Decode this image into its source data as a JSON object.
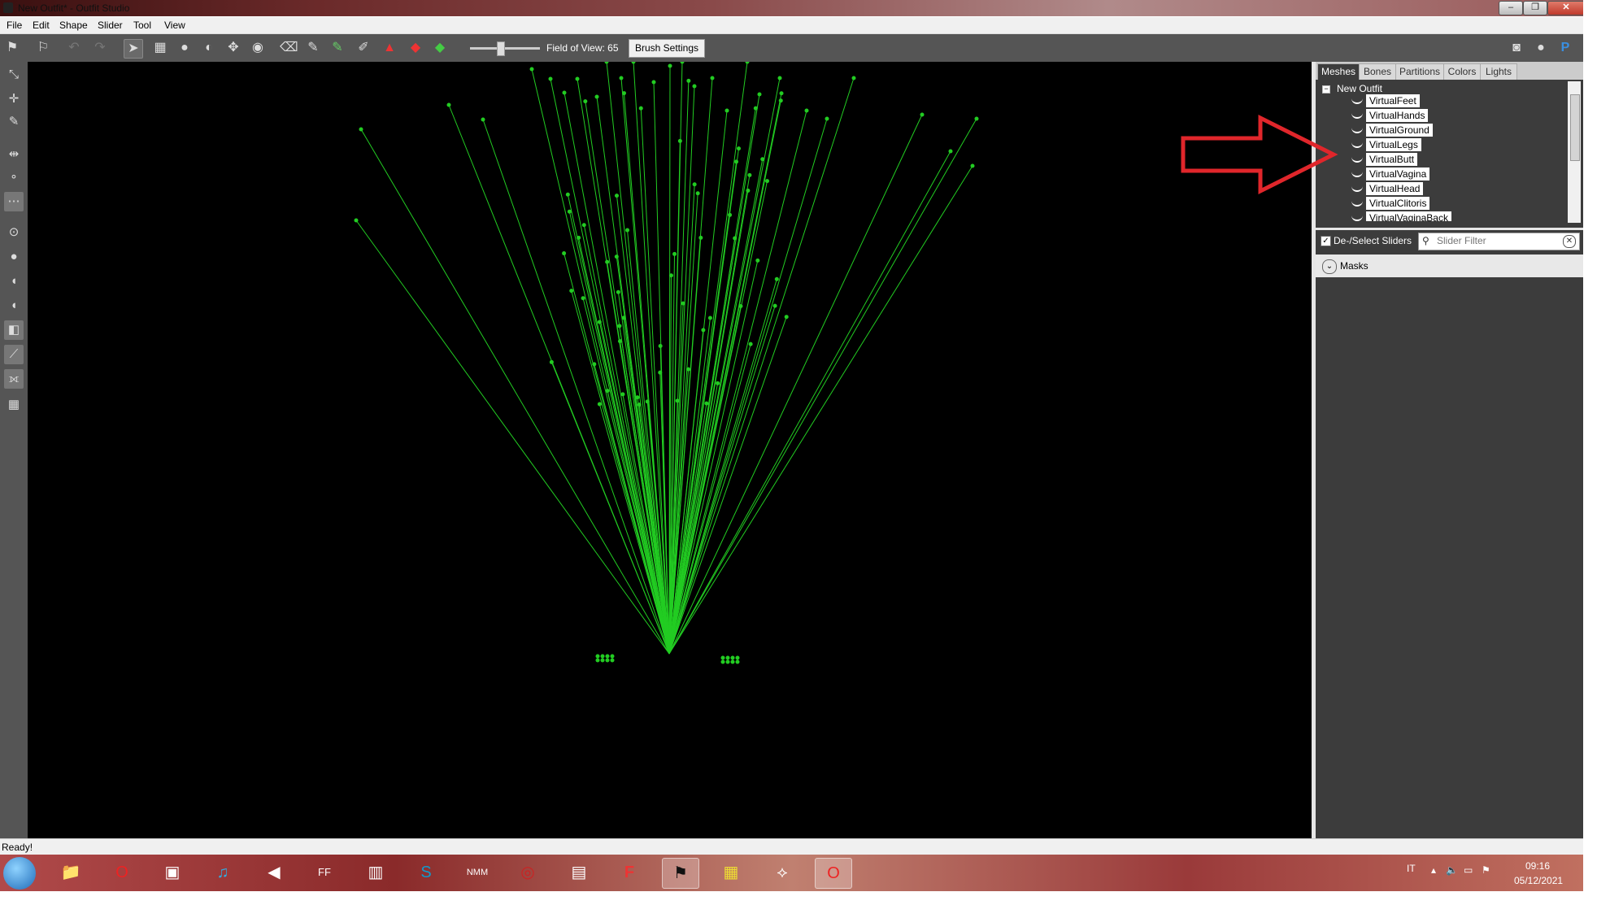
{
  "window": {
    "title": "New Outfit* - Outfit Studio"
  },
  "menu": [
    "File",
    "Edit",
    "Shape",
    "Slider",
    "Tool",
    "View"
  ],
  "toolbar": {
    "fov_label": "Field of View: 65",
    "brush_settings": "Brush Settings",
    "icons": [
      "load-reference-icon",
      "load-outfit-icon",
      "undo-icon",
      "redo-icon",
      "select-brush-icon",
      "mask-brush-icon",
      "inflate-brush-icon",
      "deflate-brush-icon",
      "move-brush-icon",
      "smooth-brush-icon",
      "undiff-brush-icon",
      "weight-brush-icon",
      "color-brush-icon",
      "alpha-brush-icon",
      "collapse-vertex-icon",
      "flip-edge-icon",
      "split-edge-icon"
    ],
    "links": [
      "discord-icon",
      "github-icon",
      "paypal-icon"
    ]
  },
  "left_tools": [
    "transform-icon",
    "pivot-icon",
    "vertex-edit-icon",
    "mirror-icon",
    "brush-size-icon",
    "brush-strength-icon",
    "point-icon",
    "small-circle-icon",
    "circle-icon",
    "large-circle-icon",
    "partial-circle-icon",
    "cube-icon",
    "bone-icon",
    "brush-settings-icon",
    "wireframe-icon"
  ],
  "tabs": [
    "Meshes",
    "Bones",
    "Partitions",
    "Colors",
    "Lights"
  ],
  "active_tab": "Meshes",
  "tree": {
    "root": "New Outfit",
    "items": [
      "VirtualFeet",
      "VirtualHands",
      "VirtualGround",
      "VirtualLegs",
      "VirtualButt",
      "VirtualVagina",
      "VirtualHead",
      "VirtualClitoris",
      "VirtualVaginaBack"
    ]
  },
  "sliders": {
    "deselect_label": "De-/Select Sliders",
    "filter_placeholder": "Slider Filter",
    "masks_label": "Masks"
  },
  "status": {
    "text": "Ready!"
  },
  "taskbar": {
    "apps": [
      "file-explorer",
      "opera",
      "media-player",
      "itunes",
      "audio",
      "ffdec",
      "pipes",
      "skype",
      "nmm",
      "target",
      "board",
      "flash",
      "outfit-studio",
      "xray",
      "skyrim",
      "opera-gx"
    ],
    "language": "IT",
    "time": "09:16",
    "date": "05/12/2021"
  },
  "colors": {
    "wire": "#22cc22",
    "annotation_arrow": "#e0262b"
  }
}
